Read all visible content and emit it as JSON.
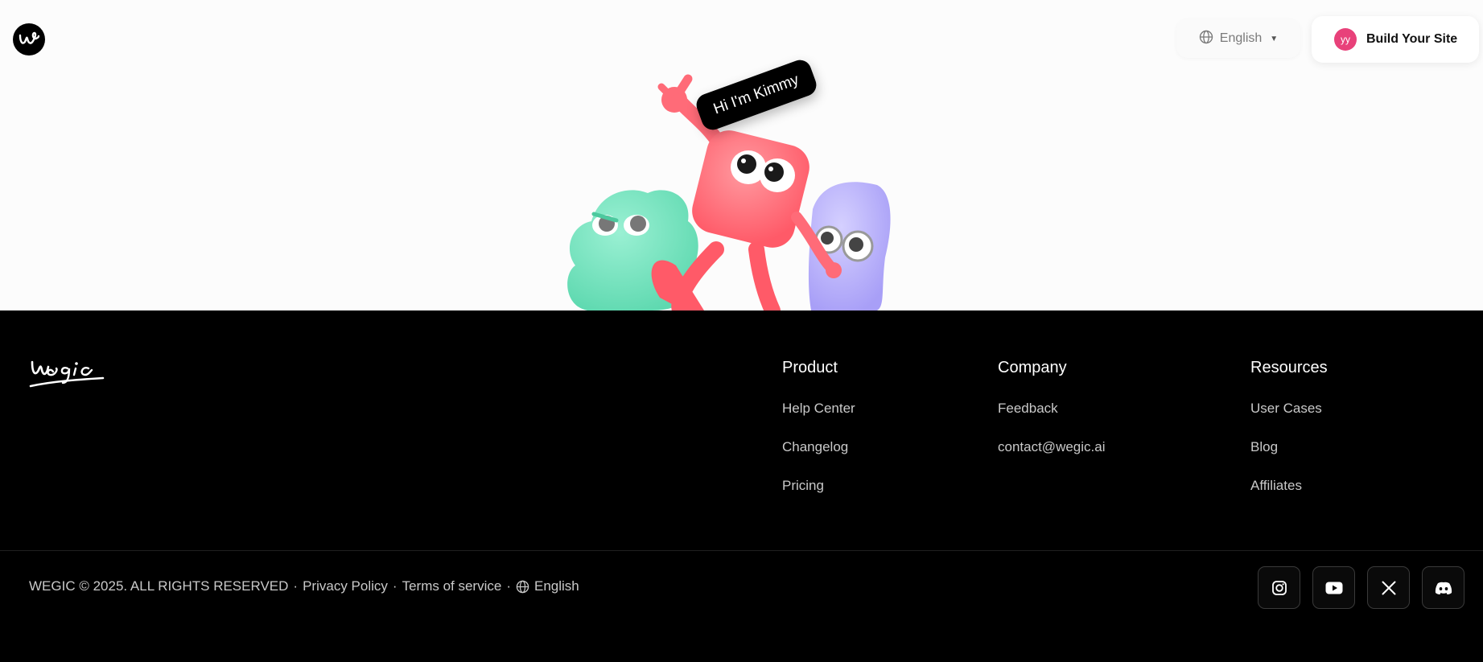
{
  "header": {
    "language_label": "English",
    "build_button_label": "Build Your Site",
    "avatar_initials": "yy"
  },
  "hero": {
    "speech_bubble": "Hi I'm Kimmy"
  },
  "footer": {
    "columns": [
      {
        "title": "Product",
        "links": [
          "Help Center",
          "Changelog",
          "Pricing"
        ]
      },
      {
        "title": "Company",
        "links": [
          "Feedback",
          "contact@wegic.ai"
        ]
      },
      {
        "title": "Resources",
        "links": [
          "User Cases",
          "Blog",
          "Affiliates"
        ]
      }
    ],
    "copyright": "WEGIC © 2025. ALL RIGHTS RESERVED",
    "privacy_label": "Privacy Policy",
    "terms_label": "Terms of service",
    "language_label": "English",
    "separator": "·",
    "socials": [
      "instagram-icon",
      "youtube-icon",
      "x-icon",
      "discord-icon"
    ]
  },
  "colors": {
    "avatar": "#e8417a",
    "footer_bg": "#000000",
    "mascot_red": "#ff6b78",
    "mascot_green": "#6fe3bd",
    "mascot_purple": "#b9b2ff"
  }
}
